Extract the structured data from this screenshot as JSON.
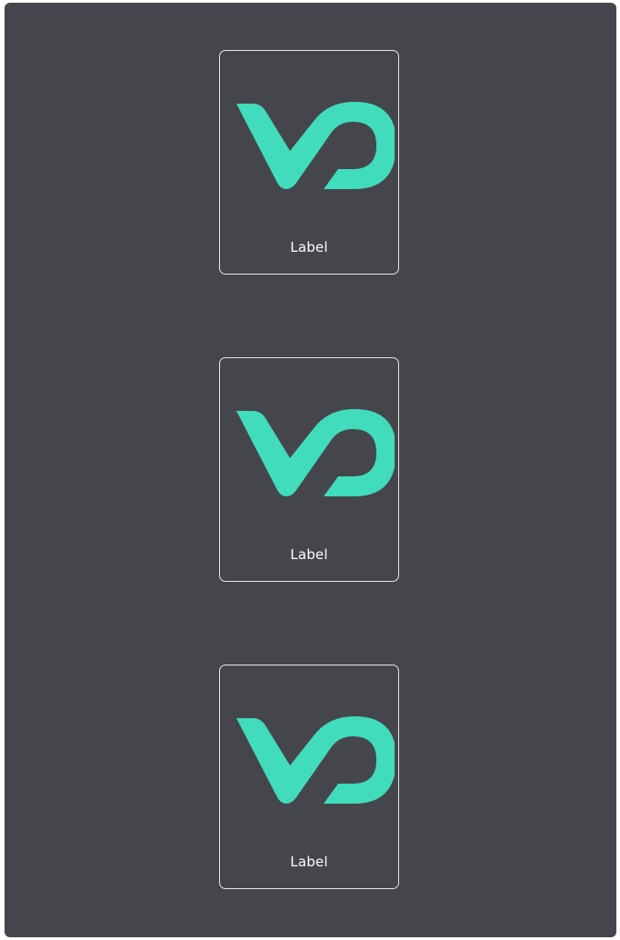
{
  "brand_color": "#41dcbc",
  "panel_color": "#45464b",
  "cards": [
    {
      "icon": "vd-logo-icon",
      "label": "Label"
    },
    {
      "icon": "vd-logo-icon",
      "label": "Label"
    },
    {
      "icon": "vd-logo-icon",
      "label": "Label"
    }
  ]
}
